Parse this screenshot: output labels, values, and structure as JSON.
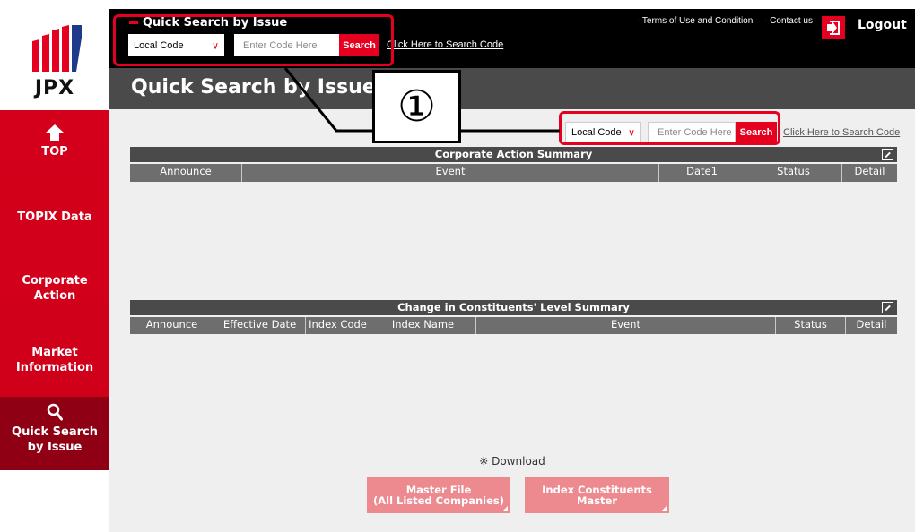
{
  "brand": {
    "logo_text": "JPX",
    "logo_color": "#e60020"
  },
  "sidebar": {
    "items": [
      {
        "label": "TOP",
        "icon": "home-icon"
      },
      {
        "label": "TOPIX Data"
      },
      {
        "label": "Corporate Action"
      },
      {
        "label": "Market Information"
      },
      {
        "label": "Quick Search by Issue",
        "icon": "search-icon",
        "active": true
      }
    ]
  },
  "header": {
    "quick_search_title": "Quick Search by Issue",
    "select_value": "Local Code",
    "input_placeholder": "Enter Code Here",
    "search_label": "Search",
    "search_code_link": "Click Here to Search Code",
    "links": [
      "· Terms of Use and Condition",
      "· Contact us"
    ],
    "logout_label": "Logout"
  },
  "page": {
    "title": "Quick Search by Issue",
    "search": {
      "select_value": "Local Code",
      "input_placeholder": "Enter Code Here",
      "search_label": "Search",
      "search_code_link": "Click Here to Search Code"
    }
  },
  "corporate_action_table": {
    "title": "Corporate Action Summary",
    "columns": [
      "Announce",
      "Event",
      "Date1",
      "Status",
      "Detail"
    ]
  },
  "constituents_table": {
    "title": "Change in Constituents' Level Summary",
    "columns": [
      "Announce",
      "Effective Date",
      "Index Code",
      "Index Name",
      "Event",
      "Status",
      "Detail"
    ]
  },
  "download": {
    "note": "※ Download",
    "master_file_label": "Master File\n(All Listed Companies)",
    "index_master_label": "Index Constituents\nMaster"
  },
  "annotation": {
    "marker": "①",
    "color": "#e60020"
  }
}
